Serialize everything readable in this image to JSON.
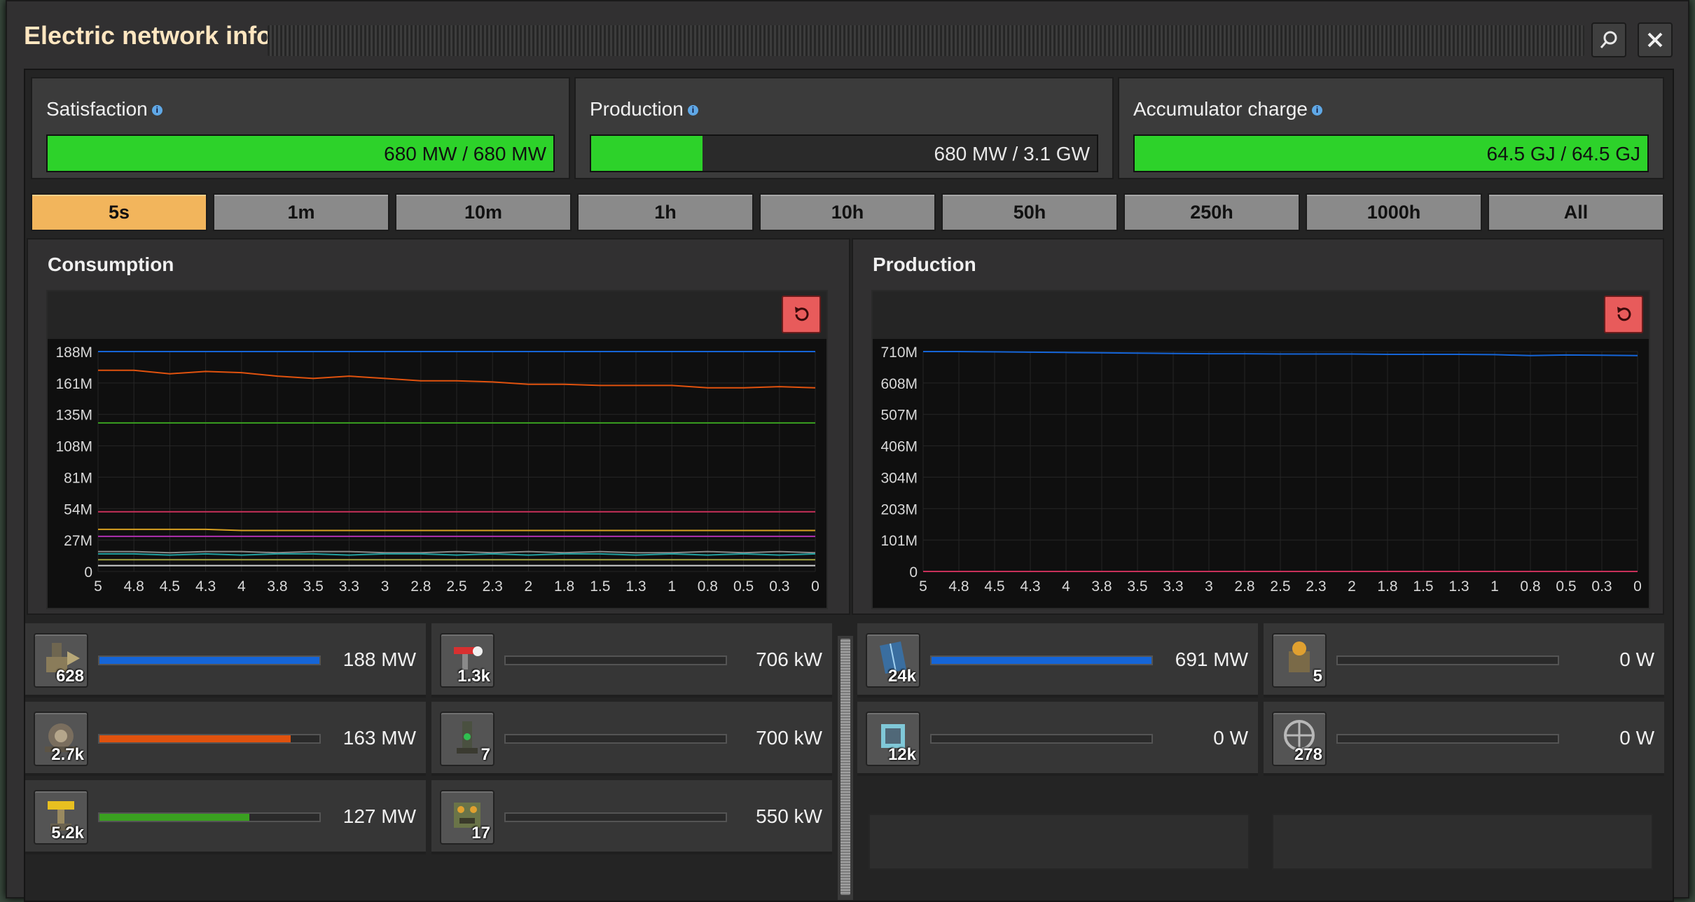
{
  "window": {
    "title": "Electric network info"
  },
  "stats": [
    {
      "label": "Satisfaction",
      "value": "680 MW / 680 MW",
      "fill": 1.0
    },
    {
      "label": "Production",
      "value": "680 MW / 3.1 GW",
      "fill": 0.22
    },
    {
      "label": "Accumulator charge",
      "value": "64.5 GJ / 64.5 GJ",
      "fill": 1.0
    }
  ],
  "tabs": [
    "5s",
    "1m",
    "10m",
    "1h",
    "10h",
    "50h",
    "250h",
    "1000h",
    "All"
  ],
  "active_tab": "5s",
  "consumption": {
    "title": "Consumption",
    "left": [
      {
        "icon": "mining-drill-icon",
        "count": "628",
        "value": "188 MW",
        "fill": 1.0,
        "color": "#1565d8"
      },
      {
        "icon": "pumpjack-icon",
        "count": "2.7k",
        "value": "163 MW",
        "fill": 0.87,
        "color": "#e0520e"
      },
      {
        "icon": "inserter-icon",
        "count": "5.2k",
        "value": "127 MW",
        "fill": 0.68,
        "color": "#3aa020"
      }
    ],
    "right": [
      {
        "icon": "fast-inserter-icon",
        "count": "1.3k",
        "value": "706 kW",
        "fill": 0,
        "color": "#888888"
      },
      {
        "icon": "radar-icon",
        "count": "7",
        "value": "700 kW",
        "fill": 0,
        "color": "#888888"
      },
      {
        "icon": "assembler-icon",
        "count": "17",
        "value": "550 kW",
        "fill": 0,
        "color": "#888888"
      }
    ]
  },
  "production": {
    "title": "Production",
    "left": [
      {
        "icon": "solar-panel-icon",
        "count": "24k",
        "value": "691 MW",
        "fill": 1.0,
        "color": "#1565d8"
      },
      {
        "icon": "accumulator-icon",
        "count": "12k",
        "value": "0 W",
        "fill": 0,
        "color": "#888888"
      }
    ],
    "right": [
      {
        "icon": "steam-engine-icon",
        "count": "5",
        "value": "0 W",
        "fill": 0,
        "color": "#888888"
      },
      {
        "icon": "steam-turbine-icon",
        "count": "278",
        "value": "0 W",
        "fill": 0,
        "color": "#888888"
      }
    ]
  },
  "chart_data": [
    {
      "type": "line",
      "title": "Consumption",
      "x": [
        5,
        4.8,
        4.5,
        4.3,
        4,
        3.8,
        3.5,
        3.3,
        3,
        2.8,
        2.5,
        2.3,
        2,
        1.8,
        1.5,
        1.3,
        1,
        0.8,
        0.5,
        0.3,
        0
      ],
      "x_ticks": [
        "5",
        "4.8",
        "4.5",
        "4.3",
        "4",
        "3.8",
        "3.5",
        "3.3",
        "3",
        "2.8",
        "2.5",
        "2.3",
        "2",
        "1.8",
        "1.5",
        "1.3",
        "1",
        "0.8",
        "0.5",
        "0.3",
        "0"
      ],
      "y_ticks": [
        "188M",
        "161M",
        "135M",
        "108M",
        "81M",
        "54M",
        "27M",
        "0"
      ],
      "ylim": [
        0,
        188000000
      ],
      "series": [
        {
          "color": "#1565d8",
          "values": [
            188,
            188,
            188,
            188,
            188,
            188,
            188,
            188,
            188,
            188,
            188,
            188,
            188,
            188,
            188,
            188,
            188,
            188,
            188,
            188,
            188
          ]
        },
        {
          "color": "#e0520e",
          "values": [
            172,
            172,
            169,
            171,
            170,
            167,
            165,
            167,
            165,
            163,
            163,
            162,
            160,
            160,
            159,
            159,
            159,
            157,
            157,
            158,
            157
          ]
        },
        {
          "color": "#3aa020",
          "values": [
            127,
            127,
            127,
            127,
            127,
            127,
            127,
            127,
            127,
            127,
            127,
            127,
            127,
            127,
            127,
            127,
            127,
            127,
            127,
            127,
            127
          ]
        },
        {
          "color": "#c8305a",
          "values": [
            51,
            51,
            51,
            51,
            51,
            51,
            51,
            51,
            51,
            51,
            51,
            51,
            51,
            51,
            51,
            51,
            51,
            51,
            51,
            51,
            51
          ]
        },
        {
          "color": "#d8a020",
          "values": [
            36,
            36,
            36,
            36,
            35,
            35,
            35,
            35,
            35,
            35,
            35,
            35,
            35,
            35,
            35,
            35,
            35,
            35,
            35,
            35,
            35
          ]
        },
        {
          "color": "#b030b0",
          "values": [
            30,
            30,
            30,
            30,
            30,
            30,
            30,
            30,
            30,
            30,
            30,
            30,
            30,
            30,
            30,
            30,
            30,
            30,
            30,
            30,
            30
          ]
        },
        {
          "color": "#8a8a8a",
          "values": [
            17,
            17,
            16,
            17,
            17,
            16,
            17,
            17,
            16,
            16,
            17,
            16,
            17,
            16,
            17,
            16,
            16,
            17,
            16,
            17,
            16
          ]
        },
        {
          "color": "#20a0a0",
          "values": [
            15,
            15,
            14,
            15,
            14,
            15,
            15,
            14,
            15,
            15,
            14,
            15,
            14,
            15,
            15,
            14,
            15,
            14,
            15,
            14,
            15
          ]
        },
        {
          "color": "#a0a040",
          "values": [
            10,
            10,
            10,
            10,
            10,
            10,
            10,
            10,
            10,
            10,
            10,
            10,
            10,
            10,
            10,
            10,
            10,
            10,
            10,
            10,
            10
          ]
        },
        {
          "color": "#d0d0d0",
          "values": [
            5,
            5,
            5,
            5,
            5,
            5,
            5,
            5,
            5,
            5,
            5,
            5,
            5,
            5,
            5,
            5,
            5,
            5,
            5,
            5,
            5
          ]
        }
      ]
    },
    {
      "type": "line",
      "title": "Production",
      "x": [
        5,
        4.8,
        4.5,
        4.3,
        4,
        3.8,
        3.5,
        3.3,
        3,
        2.8,
        2.5,
        2.3,
        2,
        1.8,
        1.5,
        1.3,
        1,
        0.8,
        0.5,
        0.3,
        0
      ],
      "x_ticks": [
        "5",
        "4.8",
        "4.5",
        "4.3",
        "4",
        "3.8",
        "3.5",
        "3.3",
        "3",
        "2.8",
        "2.5",
        "2.3",
        "2",
        "1.8",
        "1.5",
        "1.3",
        "1",
        "0.8",
        "0.5",
        "0.3",
        "0"
      ],
      "y_ticks": [
        "710M",
        "608M",
        "507M",
        "406M",
        "304M",
        "203M",
        "101M",
        "0"
      ],
      "ylim": [
        0,
        710000000
      ],
      "series": [
        {
          "color": "#1565d8",
          "values": [
            710,
            710,
            709,
            708,
            707,
            706,
            705,
            704,
            703,
            703,
            702,
            702,
            702,
            701,
            701,
            701,
            700,
            697,
            699,
            698,
            697
          ]
        },
        {
          "color": "#c8305a",
          "values": [
            0,
            0,
            0,
            0,
            0,
            0,
            0,
            0,
            0,
            0,
            0,
            0,
            0,
            0,
            0,
            0,
            0,
            0,
            0,
            0,
            0
          ]
        }
      ]
    }
  ]
}
